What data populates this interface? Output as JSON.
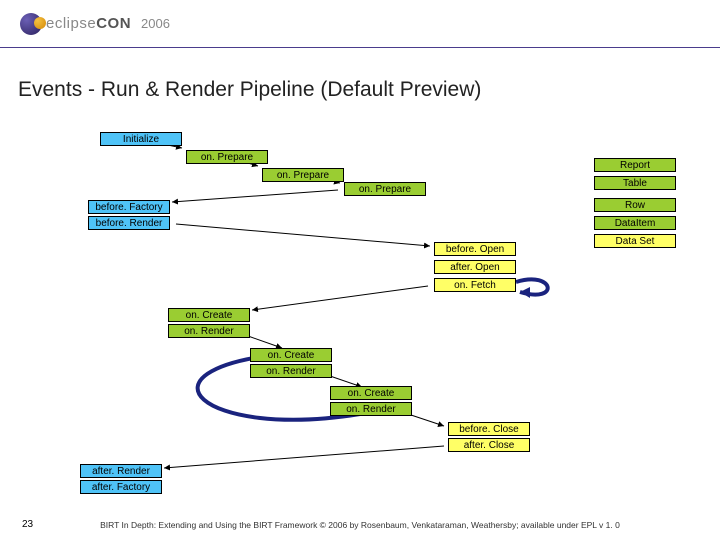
{
  "header": {
    "brand_prefix": "eclipse",
    "brand_suffix": "CON",
    "year": "2006"
  },
  "title": "Events - Run & Render Pipeline (Default Preview)",
  "boxes": {
    "initialize": "Initialize",
    "onPrepare1": "on. Prepare",
    "onPrepare2": "on. Prepare",
    "onPrepare3": "on. Prepare",
    "beforeFactory": "before. Factory",
    "beforeRender": "before. Render",
    "beforeOpen": "before. Open",
    "afterOpen": "after. Open",
    "onFetch": "on. Fetch",
    "onCreate1": "on. Create",
    "onRender1": "on. Render",
    "onCreate2": "on. Create",
    "onRender2": "on. Render",
    "onCreate3": "on. Create",
    "onRender3": "on. Render",
    "beforeClose": "before. Close",
    "afterClose": "after. Close",
    "afterRender": "after. Render",
    "afterFactory": "after. Factory",
    "legendReport": "Report",
    "legendTable": "Table",
    "legendRow": "Row",
    "legendDataItem": "DataItem",
    "legendDataSet": "Data Set"
  },
  "footer": "BIRT In Depth: Extending and Using the BIRT Framework © 2006 by Rosenbaum, Venkataraman, Weathersby; available under EPL v 1. 0",
  "page_number": "23",
  "chart_data": {
    "type": "flow-diagram",
    "description": "BIRT event pipeline for Run & Render (default preview) showing event ordering and scope legend",
    "sequence": [
      "Initialize",
      "on.Prepare (Report)",
      "on.Prepare (Table)",
      "on.Prepare (Row/DataItem)",
      "before.Factory",
      "before.Render",
      "before.Open",
      "after.Open",
      "on.Fetch (loop)",
      "on.Create (Table)",
      "on.Render (Table)",
      "on.Create (Row)",
      "on.Render (Row)",
      "on.Create (DataItem)",
      "on.Render (DataItem)",
      "before.Close",
      "after.Close",
      "after.Render",
      "after.Factory"
    ],
    "legend_scope_colors": {
      "Report": "green",
      "Table": "green",
      "Row": "green",
      "DataItem": "green",
      "Data Set": "yellow"
    },
    "event_colors": {
      "on.*": "green",
      "before.* / after.* (report)": "blue",
      "before.* / after.* (dataset)": "yellow",
      "Initialize": "blue"
    },
    "loops": [
      {
        "event": "on.Fetch",
        "loops_back_to": "on.Fetch"
      },
      {
        "from": "on.Render (DataItem)",
        "loops_back_to": "on.Create (Row)"
      }
    ]
  }
}
